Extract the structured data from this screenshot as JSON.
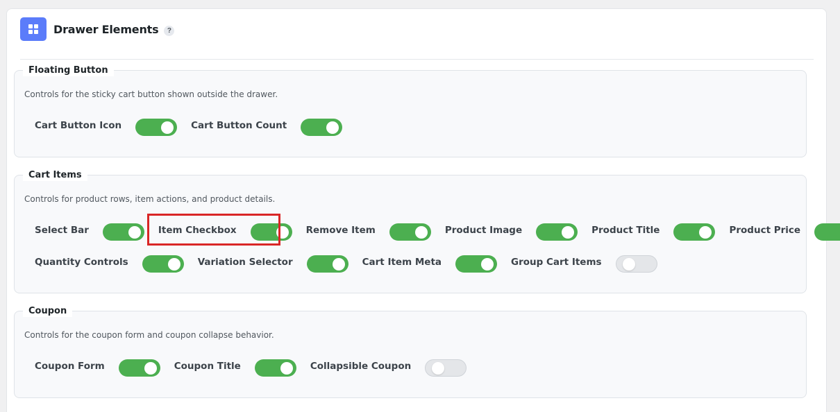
{
  "header": {
    "title": "Drawer Elements",
    "help_badge": "?",
    "icon": "grid-icon"
  },
  "colors": {
    "accent": "#5b7cfa",
    "toggle_on": "#4caf50",
    "toggle_off": "#e4e6e9",
    "highlight": "#d92626"
  },
  "groups": {
    "floating": {
      "title": "Floating Button",
      "description": "Controls for the sticky cart button shown outside the drawer.",
      "toggles": [
        {
          "label": "Cart Button Icon",
          "on": true
        },
        {
          "label": "Cart Button Count",
          "on": true
        }
      ]
    },
    "cart_items": {
      "title": "Cart Items",
      "description": "Controls for product rows, item actions, and product details.",
      "toggles": [
        {
          "label": "Select Bar",
          "on": true
        },
        {
          "label": "Item Checkbox",
          "on": true
        },
        {
          "label": "Remove Item",
          "on": true
        },
        {
          "label": "Product Image",
          "on": true
        },
        {
          "label": "Product Title",
          "on": true
        },
        {
          "label": "Product Price",
          "on": true
        },
        {
          "label": "Quantity Controls",
          "on": true
        },
        {
          "label": "Variation Selector",
          "on": true
        },
        {
          "label": "Cart Item Meta",
          "on": true
        },
        {
          "label": "Group Cart Items",
          "on": false
        }
      ]
    },
    "coupon": {
      "title": "Coupon",
      "description": "Controls for the coupon form and coupon collapse behavior.",
      "toggles": [
        {
          "label": "Coupon Form",
          "on": true
        },
        {
          "label": "Coupon Title",
          "on": true
        },
        {
          "label": "Collapsible Coupon",
          "on": false
        }
      ]
    }
  }
}
